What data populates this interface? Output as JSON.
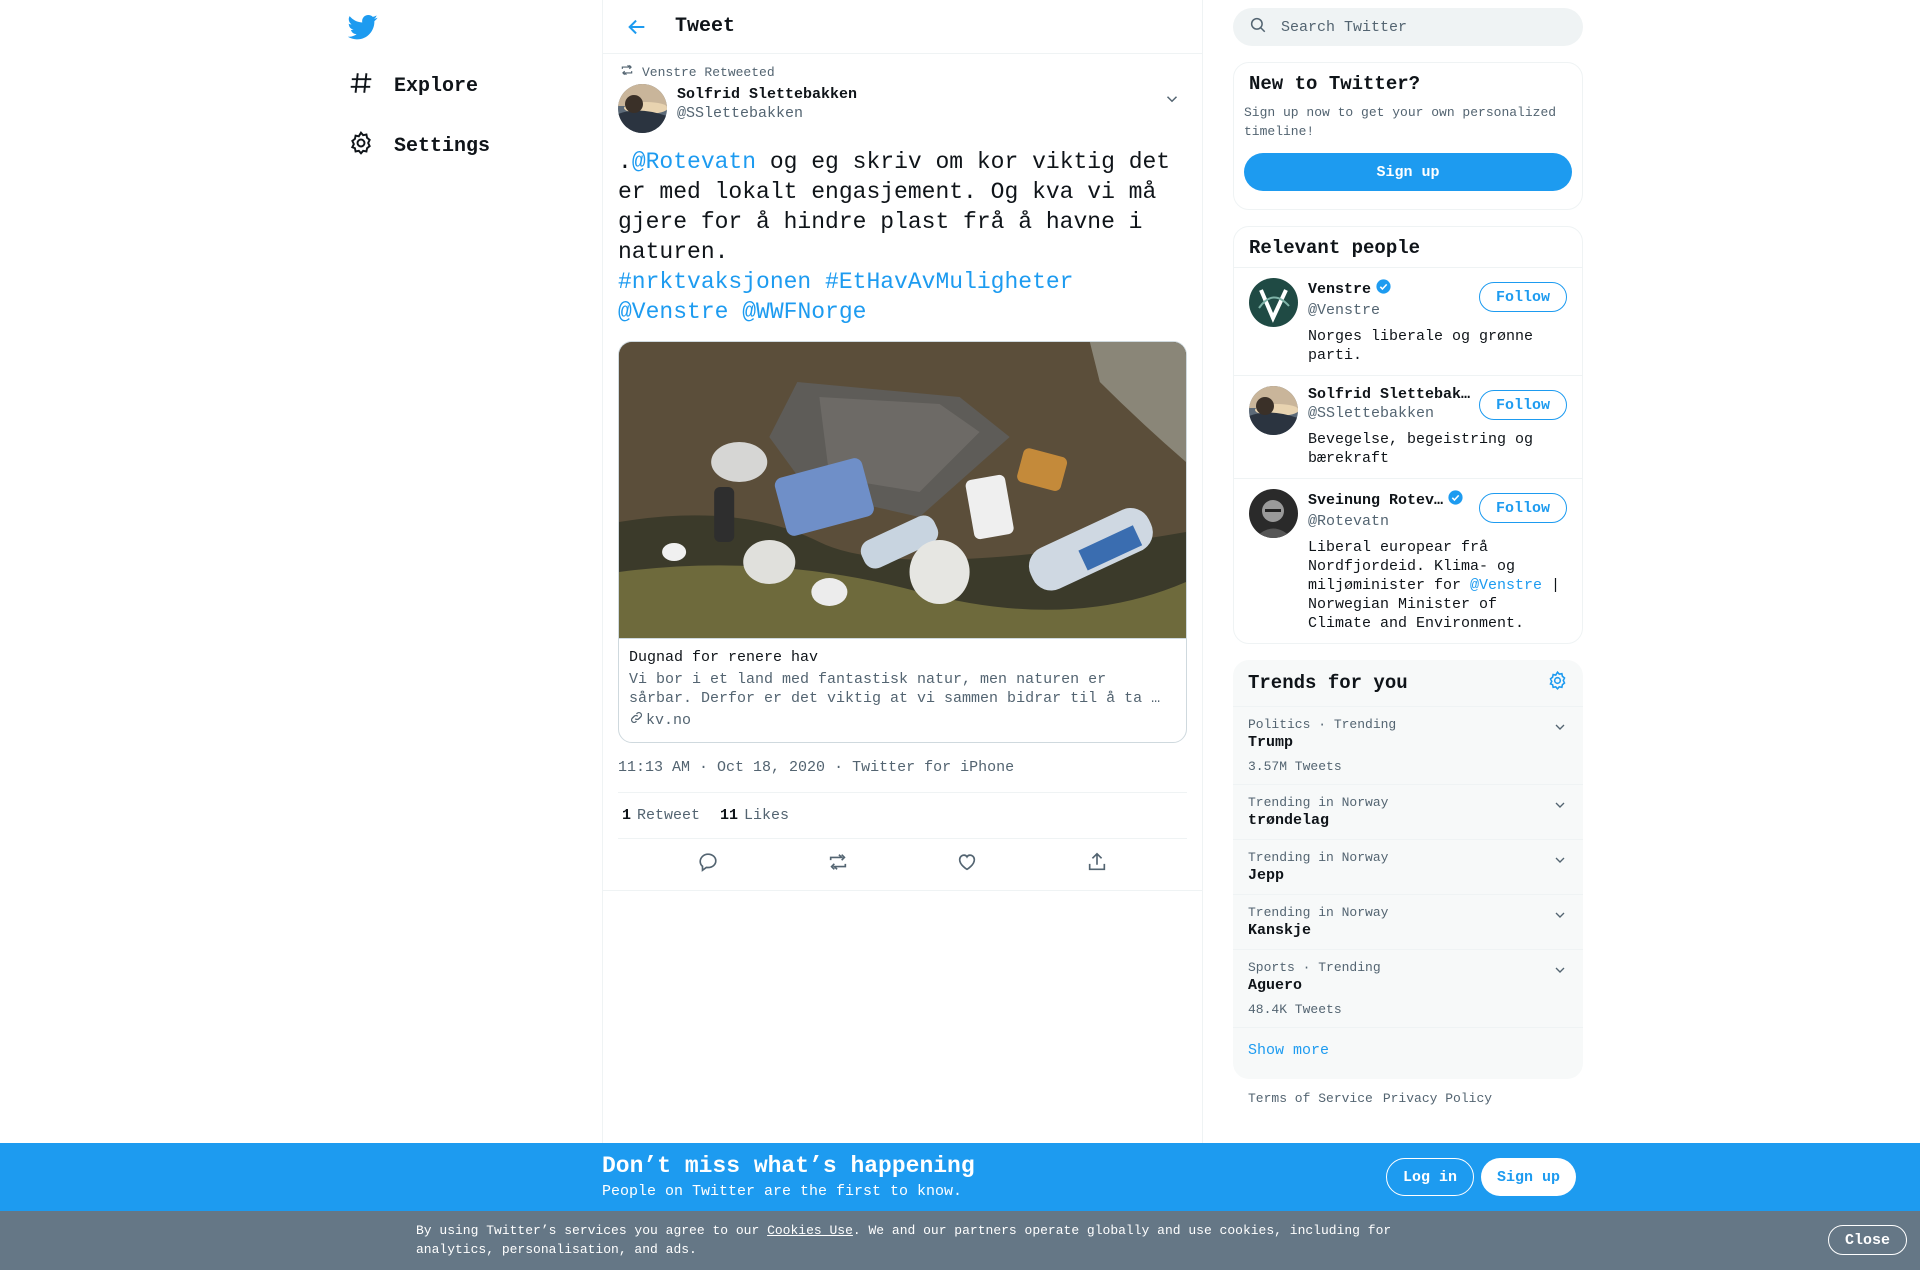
{
  "nav": {
    "logo_icon": "twitter-bird-icon",
    "items": [
      {
        "label": "Explore",
        "icon": "hashtag-icon"
      },
      {
        "label": "Settings",
        "icon": "gear-icon"
      }
    ]
  },
  "header": {
    "title": "Tweet"
  },
  "tweet": {
    "retweeted_by": "Venstre Retweeted",
    "author_name": "Solfrid Slettebakken",
    "author_handle": "@SSlettebakken",
    "text_parts": [
      {
        "t": "text",
        "v": "."
      },
      {
        "t": "mention",
        "v": "@Rotevatn"
      },
      {
        "t": "text",
        "v": " og eg skriv om kor viktig det er med lokalt engasjement. Og kva vi må gjere for å hindre plast frå å havne i naturen.\n"
      },
      {
        "t": "hashtag",
        "v": "#nrktvaksjonen"
      },
      {
        "t": "text",
        "v": " "
      },
      {
        "t": "hashtag",
        "v": "#EtHavAvMuligheter"
      },
      {
        "t": "text",
        "v": " "
      },
      {
        "t": "mention",
        "v": "@Venstre"
      },
      {
        "t": "text",
        "v": " "
      },
      {
        "t": "mention",
        "v": "@WWFNorge"
      }
    ],
    "card": {
      "title": "Dugnad for renere hav",
      "description": "Vi bor i et land med fantastisk natur, men naturen er sårbar. Derfor er det viktig at vi sammen bidrar til å ta …",
      "domain": "kv.no"
    },
    "time": "11:13 AM · Oct 18, 2020",
    "source": "Twitter for iPhone",
    "retweet_count": "1",
    "retweet_label": "Retweet",
    "like_count": "11",
    "like_label": "Likes"
  },
  "search": {
    "placeholder": "Search Twitter"
  },
  "new_to_twitter": {
    "title": "New to Twitter?",
    "subtitle": "Sign up now to get your own personalized timeline!",
    "button": "Sign up"
  },
  "relevant_people": {
    "title": "Relevant people",
    "follow_label": "Follow",
    "people": [
      {
        "name": "Venstre",
        "handle": "@Venstre",
        "verified": true,
        "bio": "Norges liberale og grønne parti."
      },
      {
        "name": "Solfrid Slettebak…",
        "handle": "@SSlettebakken",
        "verified": false,
        "bio": "Bevegelse, begeistring og bærekraft"
      },
      {
        "name": "Sveinung Rotev…",
        "handle": "@Rotevatn",
        "verified": true,
        "bio_pre": "Liberal europear frå Nordfjordeid. Klima- og miljøminister for ",
        "bio_mention": "@Venstre",
        "bio_post": " | Norwegian Minister of Climate and Environment."
      }
    ]
  },
  "trends": {
    "title": "Trends for you",
    "items": [
      {
        "context": "Politics · Trending",
        "name": "Trump",
        "count": "3.57M Tweets"
      },
      {
        "context": "Trending in Norway",
        "name": "trøndelag",
        "count": ""
      },
      {
        "context": "Trending in Norway",
        "name": "Jepp",
        "count": ""
      },
      {
        "context": "Trending in Norway",
        "name": "Kanskje",
        "count": ""
      },
      {
        "context": "Sports · Trending",
        "name": "Aguero",
        "count": "48.4K Tweets"
      }
    ],
    "show_more": "Show more"
  },
  "footer": {
    "terms": "Terms of Service",
    "privacy": "Privacy Policy"
  },
  "login_bar": {
    "title": "Don’t miss what’s happening",
    "subtitle": "People on Twitter are the first to know.",
    "login": "Log in",
    "signup": "Sign up"
  },
  "cookie_bar": {
    "text_pre": "By using Twitter’s services you agree to our ",
    "link": "Cookies Use",
    "text_post": ". We and our partners operate globally and use cookies, including for analytics, personalisation, and ads.",
    "close": "Close"
  },
  "colors": {
    "accent": "#1d9bf0",
    "cookie_bg": "#657786"
  }
}
